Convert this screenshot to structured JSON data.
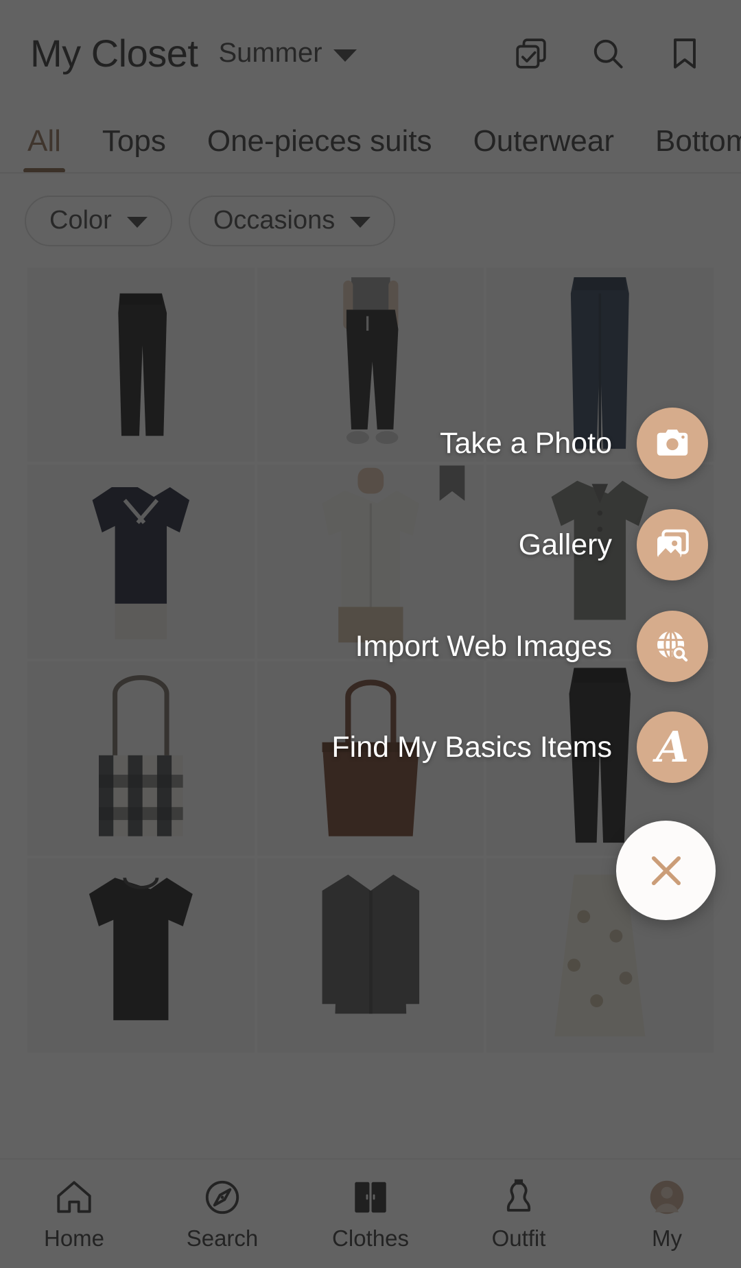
{
  "header": {
    "title": "My Closet",
    "season": "Summer",
    "season_caret_icon": "chevron-down-icon",
    "actions": [
      {
        "name": "multi-select-icon",
        "label": "Multi select"
      },
      {
        "name": "search-icon",
        "label": "Search"
      },
      {
        "name": "bookmark-icon",
        "label": "Bookmarks"
      }
    ]
  },
  "tabs": {
    "active": "All",
    "items": [
      {
        "label": "All",
        "active": true
      },
      {
        "label": "Tops",
        "active": false
      },
      {
        "label": "One-pieces suits",
        "active": false
      },
      {
        "label": "Outerwear",
        "active": false
      },
      {
        "label": "Bottoms",
        "active": false
      }
    ]
  },
  "filters": [
    {
      "label": "Color",
      "caret_icon": "chevron-down-icon"
    },
    {
      "label": "Occasions",
      "caret_icon": "chevron-down-icon"
    }
  ],
  "grid": {
    "items": [
      {
        "name": "black-flare-trousers",
        "art": "trousers",
        "bookmarked": false
      },
      {
        "name": "black-jogger-pants-model",
        "art": "jogger",
        "bookmarked": false
      },
      {
        "name": "blue-denim-jeans",
        "art": "jeans",
        "bookmarked": false
      },
      {
        "name": "navy-sailor-tshirt",
        "art": "navytee",
        "bookmarked": false
      },
      {
        "name": "white-button-shirt",
        "art": "whiteshirt",
        "bookmarked": true
      },
      {
        "name": "grey-polo-shirt",
        "art": "polo",
        "bookmarked": false
      },
      {
        "name": "checked-tote-bag",
        "art": "totecheck",
        "bookmarked": false
      },
      {
        "name": "brown-leather-tote",
        "art": "toteleather",
        "bookmarked": false
      },
      {
        "name": "black-tapered-pants",
        "art": "blackpants",
        "bookmarked": false
      },
      {
        "name": "black-tshirt",
        "art": "blacktee",
        "bookmarked": false
      },
      {
        "name": "grey-knit-cardigan",
        "art": "cardigan",
        "bookmarked": false
      },
      {
        "name": "floral-skirt",
        "art": "floral",
        "bookmarked": false
      }
    ]
  },
  "fab_menu": {
    "accent_color": "#d6ac8c",
    "items": [
      {
        "label": "Take a Photo",
        "icon": "camera-icon"
      },
      {
        "label": "Gallery",
        "icon": "photo-stack-icon"
      },
      {
        "label": "Import Web Images",
        "icon": "globe-search-icon"
      },
      {
        "label": "Find My Basics Items",
        "icon": "script-a-logo-icon"
      }
    ],
    "close": {
      "icon": "close-icon",
      "color": "#cb9d78"
    }
  },
  "bottom_nav": {
    "active": "Clothes",
    "items": [
      {
        "label": "Home",
        "icon": "home-icon",
        "active": false
      },
      {
        "label": "Search",
        "icon": "compass-icon",
        "active": false
      },
      {
        "label": "Clothes",
        "icon": "wardrobe-icon",
        "active": true
      },
      {
        "label": "Outfit",
        "icon": "mannequin-icon",
        "active": false
      },
      {
        "label": "My",
        "icon": "avatar-icon",
        "active": false
      }
    ]
  }
}
